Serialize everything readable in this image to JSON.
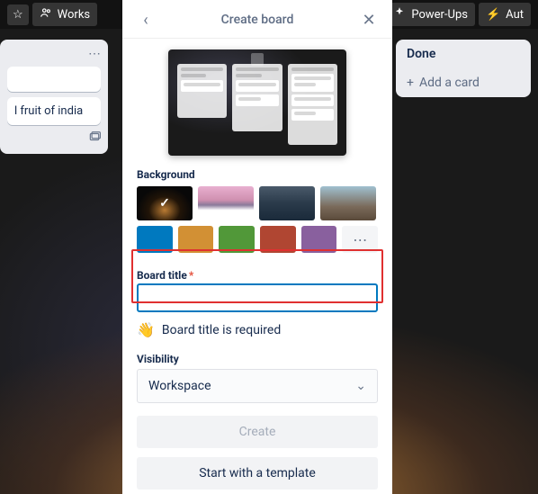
{
  "topbar": {
    "workspace_label": "Works",
    "powerups_label": "Power-Ups",
    "automation_label": "Aut"
  },
  "left_list": {
    "item_text": "l fruit of india"
  },
  "done_column": {
    "title": "Done",
    "add_card_label": "Add a card"
  },
  "modal": {
    "title": "Create board",
    "background_label": "Background",
    "colors": {
      "blue": "#0079bf",
      "orange": "#d29034",
      "green": "#519839",
      "red": "#b04632",
      "purple": "#89609e"
    },
    "board_title_label": "Board title",
    "board_title_value": "",
    "board_title_hint": "Board title is required",
    "visibility_label": "Visibility",
    "visibility_value": "Workspace",
    "create_button": "Create",
    "template_button": "Start with a template"
  }
}
